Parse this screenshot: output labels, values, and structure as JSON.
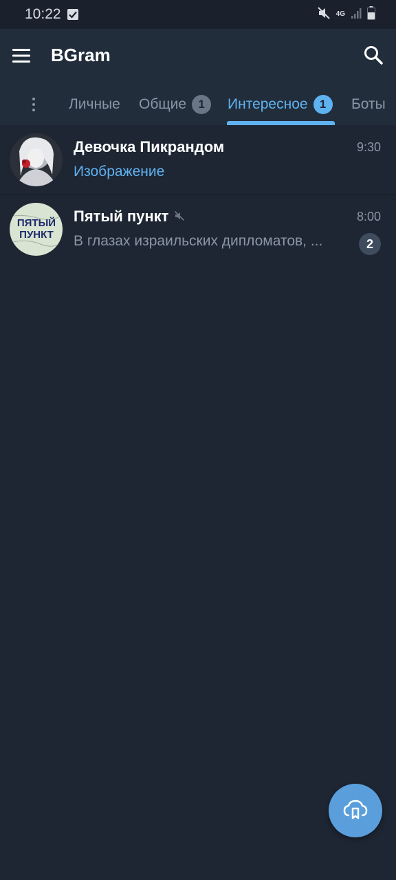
{
  "status_bar": {
    "time": "10:22",
    "network": "4G"
  },
  "app_bar": {
    "title": "BGram"
  },
  "tabs": [
    {
      "label": "Личные",
      "badge": null,
      "active": false
    },
    {
      "label": "Общие",
      "badge": "1",
      "active": false
    },
    {
      "label": "Интересное",
      "badge": "1",
      "active": true
    },
    {
      "label": "Боты",
      "badge": null,
      "active": false
    }
  ],
  "chats": [
    {
      "name": "Девочка Пикрандом",
      "time": "9:30",
      "preview": "Изображение",
      "muted": false,
      "unread": null
    },
    {
      "name": "Пятый пункт",
      "time": "8:00",
      "preview": "В глазах израильских дипломатов, ...",
      "muted": true,
      "unread": "2",
      "avatar_text": [
        "ПЯТЫЙ",
        "ПУНКТ"
      ]
    }
  ],
  "colors": {
    "background": "#1e2633",
    "app_bar": "#222d3b",
    "accent": "#5fb2f0",
    "fab": "#5a9fdc"
  },
  "icons": {
    "menu": "hamburger-menu-icon",
    "search": "search-icon",
    "fab": "cloud-bookmark-icon"
  }
}
